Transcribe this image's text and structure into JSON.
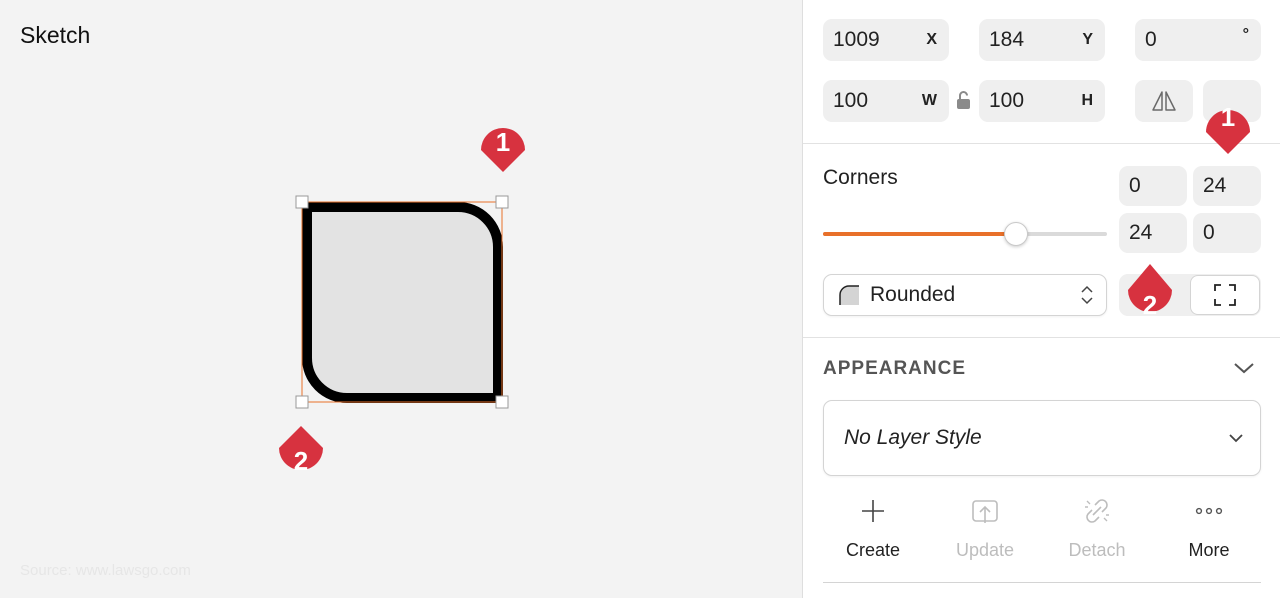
{
  "canvas": {
    "title": "Sketch",
    "watermark": "Source: www.lawsgo.com",
    "callouts": {
      "top": "1",
      "bottom": "2"
    }
  },
  "inspector": {
    "x": {
      "value": "1009",
      "unit": "X"
    },
    "y": {
      "value": "184",
      "unit": "Y"
    },
    "rotation": {
      "value": "0",
      "unit": "°"
    },
    "w": {
      "value": "100",
      "unit": "W"
    },
    "h": {
      "value": "100",
      "unit": "H"
    },
    "corners": {
      "label": "Corners",
      "values": [
        "0",
        "24",
        "24",
        "0"
      ],
      "slider_fraction": 0.68,
      "style": "Rounded",
      "callouts": {
        "top": "1",
        "bottom": "2"
      }
    },
    "appearance": {
      "title": "APPEARANCE",
      "layer_style": "No Layer Style",
      "actions": [
        {
          "label": "Create",
          "icon": "plus-icon",
          "enabled": true
        },
        {
          "label": "Update",
          "icon": "upload-icon",
          "enabled": false
        },
        {
          "label": "Detach",
          "icon": "unlink-icon",
          "enabled": false
        },
        {
          "label": "More",
          "icon": "more-icon",
          "enabled": true
        }
      ]
    }
  },
  "colors": {
    "accent": "#e8702a",
    "callout": "#d7323f",
    "selection": "#e8702a"
  }
}
